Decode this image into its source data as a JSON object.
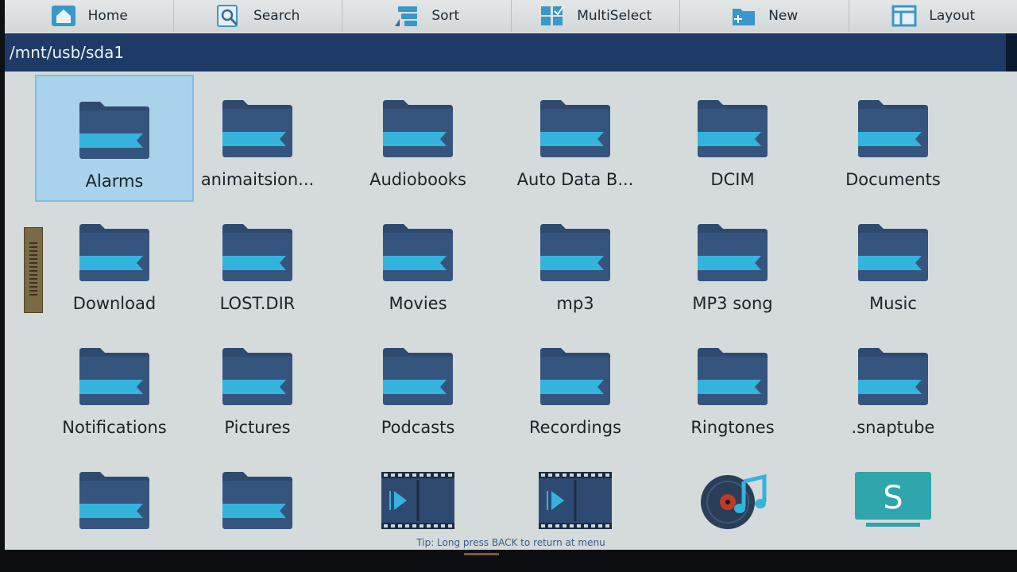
{
  "toolbar": {
    "buttons": [
      {
        "label": "Home",
        "icon": "home-icon"
      },
      {
        "label": "Search",
        "icon": "search-icon"
      },
      {
        "label": "Sort",
        "icon": "sort-icon"
      },
      {
        "label": "MultiSelect",
        "icon": "multiselect-icon"
      },
      {
        "label": "New",
        "icon": "new-folder-icon"
      },
      {
        "label": "Layout",
        "icon": "layout-icon"
      }
    ]
  },
  "path": "/mnt/usb/sda1",
  "items": [
    {
      "label": "Alarms",
      "type": "folder",
      "selected": true
    },
    {
      "label": "animaitsion...",
      "type": "folder"
    },
    {
      "label": "Audiobooks",
      "type": "folder"
    },
    {
      "label": "Auto Data B...",
      "type": "folder"
    },
    {
      "label": "DCIM",
      "type": "folder"
    },
    {
      "label": "Documents",
      "type": "folder"
    },
    {
      "label": "Download",
      "type": "folder"
    },
    {
      "label": "LOST.DIR",
      "type": "folder"
    },
    {
      "label": "Movies",
      "type": "folder"
    },
    {
      "label": "mp3",
      "type": "folder"
    },
    {
      "label": "MP3 song",
      "type": "folder"
    },
    {
      "label": "Music",
      "type": "folder"
    },
    {
      "label": "Notifications",
      "type": "folder"
    },
    {
      "label": "Pictures",
      "type": "folder"
    },
    {
      "label": "Podcasts",
      "type": "folder"
    },
    {
      "label": "Recordings",
      "type": "folder"
    },
    {
      "label": "Ringtones",
      "type": "folder"
    },
    {
      "label": ".snaptube",
      "type": "folder"
    },
    {
      "label": "",
      "type": "folder"
    },
    {
      "label": "",
      "type": "folder"
    },
    {
      "label": "",
      "type": "video"
    },
    {
      "label": "",
      "type": "video"
    },
    {
      "label": "",
      "type": "audio"
    },
    {
      "label": "",
      "type": "app"
    }
  ],
  "tip": "Tip: Long press BACK to return at menu",
  "colors": {
    "folder_body": "#2e4a70",
    "folder_band": "#34b3dc",
    "path_bar": "#1d3b66",
    "selection": "#a9d3ea",
    "app_icon": "#2fa5ad"
  }
}
